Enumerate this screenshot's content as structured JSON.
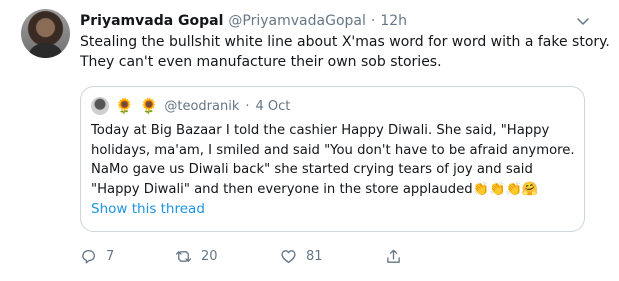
{
  "tweet": {
    "author_name": "Priyamvada Gopal",
    "author_handle": "@PriyamvadaGopal",
    "separator": "·",
    "time": "12h",
    "text_lines": [
      "Stealing the bullshit white line about X'mas word for word with a fake story.",
      "They can't even manufacture their own sob stories."
    ]
  },
  "quoted": {
    "emoji": "🌻",
    "handle": "@teodranik",
    "separator": "·",
    "date": "4 Oct",
    "text_lines": [
      "Today at Big Bazaar I told the cashier Happy Diwali. She said, \"Happy",
      "holidays, ma'am, I smiled and said \"You don't have to be afraid anymore.",
      "NaMo gave us Diwali back\" she started crying tears of joy and said",
      "\"Happy Diwali\" and then everyone in the store applauded👏👏👏🤗"
    ],
    "show_thread": "Show this thread"
  },
  "actions": {
    "replies": "7",
    "retweets": "20",
    "likes": "81"
  },
  "colors": {
    "link": "#1b95e0",
    "muted": "#657786",
    "border": "#ccd6dd"
  }
}
